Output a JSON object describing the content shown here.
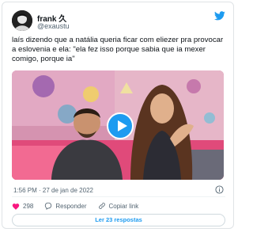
{
  "author": {
    "name": "frank 久",
    "handle": "@exaustu"
  },
  "tweet": {
    "text": "laís dizendo que a natália queria ficar com eliezer pra provocar a eslovenia e ela: \"ela fez isso porque sabia que ia mexer comigo, porque ia\"",
    "timestamp": "1:56 PM · 27 de jan de 2022"
  },
  "actions": {
    "like_count": "298",
    "reply_label": "Responder",
    "copy_link_label": "Copiar link"
  },
  "read_replies_label": "Ler 23 respostas",
  "colors": {
    "brand": "#1d9bf0",
    "heart": "#f91880",
    "muted": "#536471"
  },
  "icons": [
    "twitter-bird-icon",
    "play-icon",
    "info-icon",
    "heart-icon",
    "reply-bubble-icon",
    "link-icon"
  ]
}
